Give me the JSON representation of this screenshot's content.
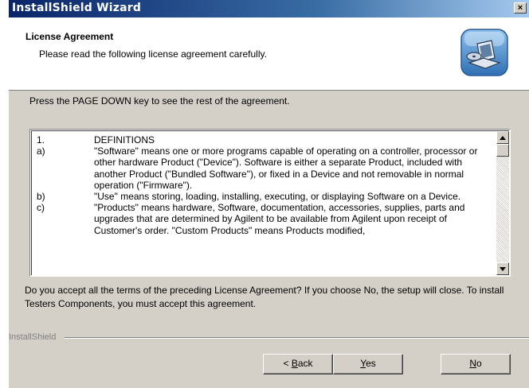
{
  "window": {
    "title": "InstallShield Wizard",
    "close_label": "×"
  },
  "header": {
    "title": "License Agreement",
    "subtitle": "Please read the following license agreement carefully."
  },
  "instruction": "Press the PAGE DOWN key to see the rest of the agreement.",
  "license": {
    "rows": [
      {
        "num": "1.",
        "text": "DEFINITIONS"
      },
      {
        "num": "a)",
        "text": "\"Software\" means one or more programs capable of operating on a controller, processor or other hardware Product (\"Device\"). Software is either a separate Product, included with another Product (\"Bundled Software\"), or fixed in a Device and not removable in normal operation (\"Firmware\")."
      },
      {
        "num": "b)",
        "text": "\"Use\" means storing, loading, installing, executing, or displaying Software on a Device."
      },
      {
        "num": "c)",
        "text": "\"Products\" means hardware, Software, documentation, accessories, supplies, parts and upgrades that are determined by Agilent to be available from Agilent upon receipt of Customer's order. \"Custom Products\" means Products modified,"
      }
    ]
  },
  "question": "Do you accept all the terms of the preceding License Agreement?  If you choose No,  the setup will close.  To install Testers Components, you must accept this agreement.",
  "brand": "InstallShield",
  "buttons": {
    "back_prefix": "< ",
    "back_key": "B",
    "back_rest": "ack",
    "yes_key": "Y",
    "yes_rest": "es",
    "no_key": "N",
    "no_rest": "o"
  },
  "icons": {
    "header": "computer-install-icon",
    "scroll_up": "arrow-up-icon",
    "scroll_down": "arrow-down-icon"
  },
  "colors": {
    "titlebar": "#0a246a",
    "face": "#d4d0c8"
  }
}
